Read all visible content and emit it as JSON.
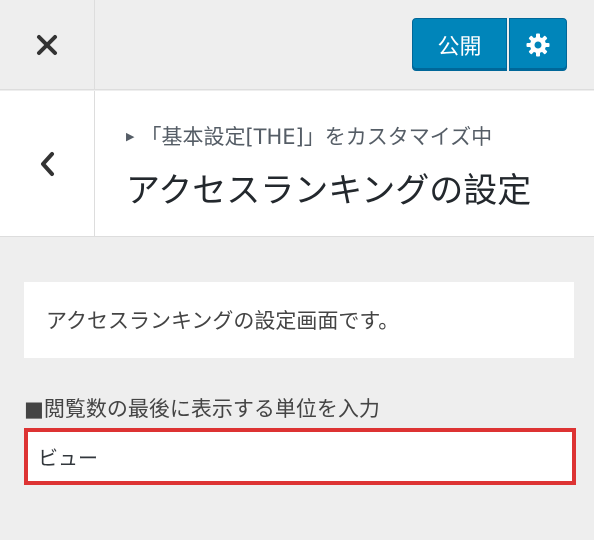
{
  "header": {
    "close_icon": "close-icon",
    "publish_label": "公開",
    "settings_icon": "gear-icon",
    "accent_color": "#0085ba"
  },
  "section": {
    "back_icon": "chevron-left-icon",
    "breadcrumb": "「基本設定[THE]」をカスタマイズ中",
    "title": "アクセスランキングの設定"
  },
  "content": {
    "description": "アクセスランキングの設定画面です。",
    "field_label": "■閲覧数の最後に表示する単位を入力",
    "field_value": "ビュー",
    "highlight_color": "#dd3333"
  }
}
